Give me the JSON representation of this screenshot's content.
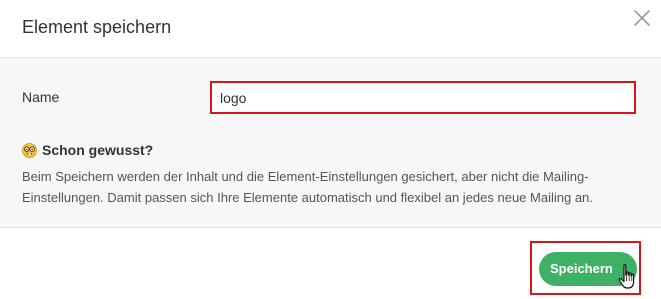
{
  "dialog": {
    "title": "Element speichern",
    "close_icon": "close-icon"
  },
  "form": {
    "name_label": "Name",
    "name_value": "logo",
    "name_placeholder": ""
  },
  "tip": {
    "icon": "nerd-face-emoji",
    "title": "Schon gewusst?",
    "text": "Beim Speichern werden der Inhalt und die Element-Einstellungen gesichert, aber nicht die Mailing-Einstellungen. Damit passen sich Ihre Elemente automatisch und flexibel an jedes neue Mailing an."
  },
  "footer": {
    "save_label": "Speichern"
  },
  "colors": {
    "accent_green": "#3eb166",
    "highlight_red": "#d7161c",
    "body_background": "#f7f7f8"
  }
}
